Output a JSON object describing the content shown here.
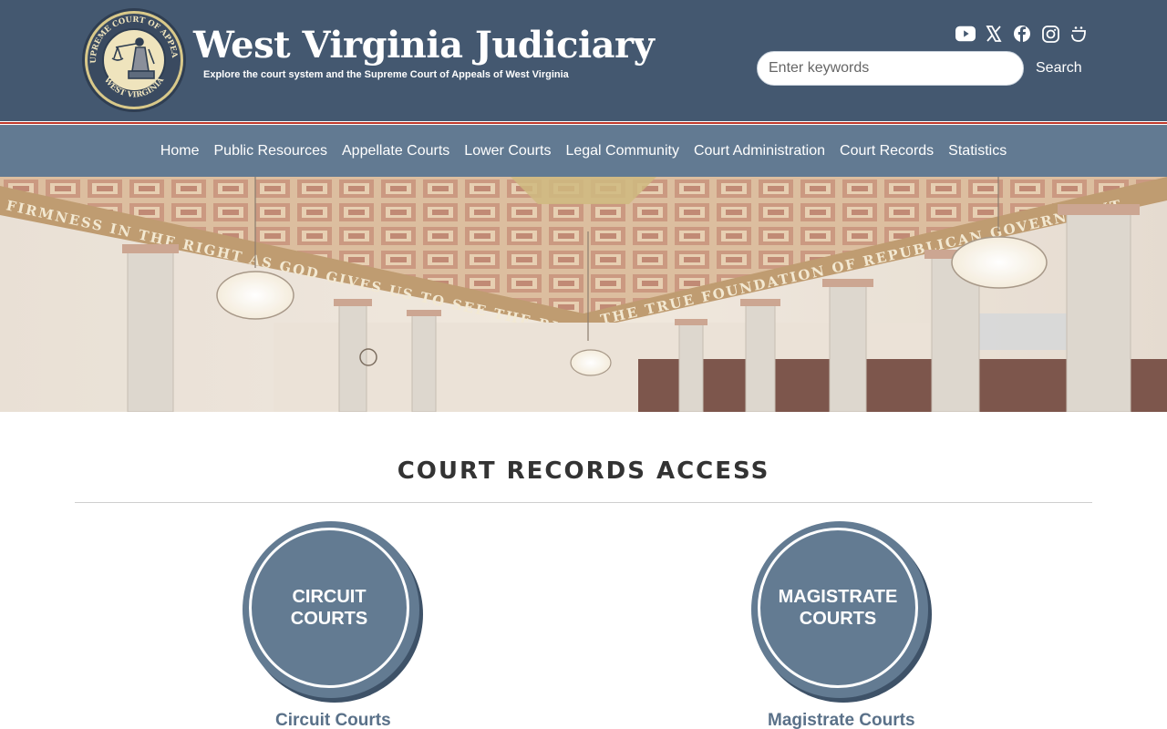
{
  "header": {
    "title": "West Virginia Judiciary",
    "tagline": "Explore the court system and the Supreme Court of Appeals of West Virginia",
    "seal": {
      "top_text": "SUPREME COURT OF APPEALS",
      "bottom_text": "WEST VIRGINIA"
    },
    "social_icons": [
      "youtube-icon",
      "x-icon",
      "facebook-icon",
      "instagram-icon",
      "threads-icon"
    ],
    "search": {
      "placeholder": "Enter keywords",
      "value": "",
      "button_label": "Search"
    }
  },
  "nav": {
    "items": [
      "Home",
      "Public Resources",
      "Appellate Courts",
      "Lower Courts",
      "Legal Community",
      "Court Administration",
      "Court Records",
      "Statistics"
    ]
  },
  "hero": {
    "inscription_left": "FIRMNESS IN THE RIGHT AS GOD GIVES US TO SEE THE RIGHT — LINCOLN",
    "inscription_right": "THE TRUE FOUNDATION OF REPUBLICAN GOVERNMENT"
  },
  "main": {
    "title": "COURT RECORDS ACCESS",
    "cards": [
      {
        "circle_label": "CIRCUIT\nCOURTS",
        "link_label": "Circuit Courts"
      },
      {
        "circle_label": "MAGISTRATE\nCOURTS",
        "link_label": "Magistrate Courts"
      }
    ]
  },
  "colors": {
    "header_bg": "#445870",
    "nav_bg": "#627a92",
    "accent_red": "#c0392b",
    "circle_bg": "#637b92",
    "link": "#5a7189"
  }
}
